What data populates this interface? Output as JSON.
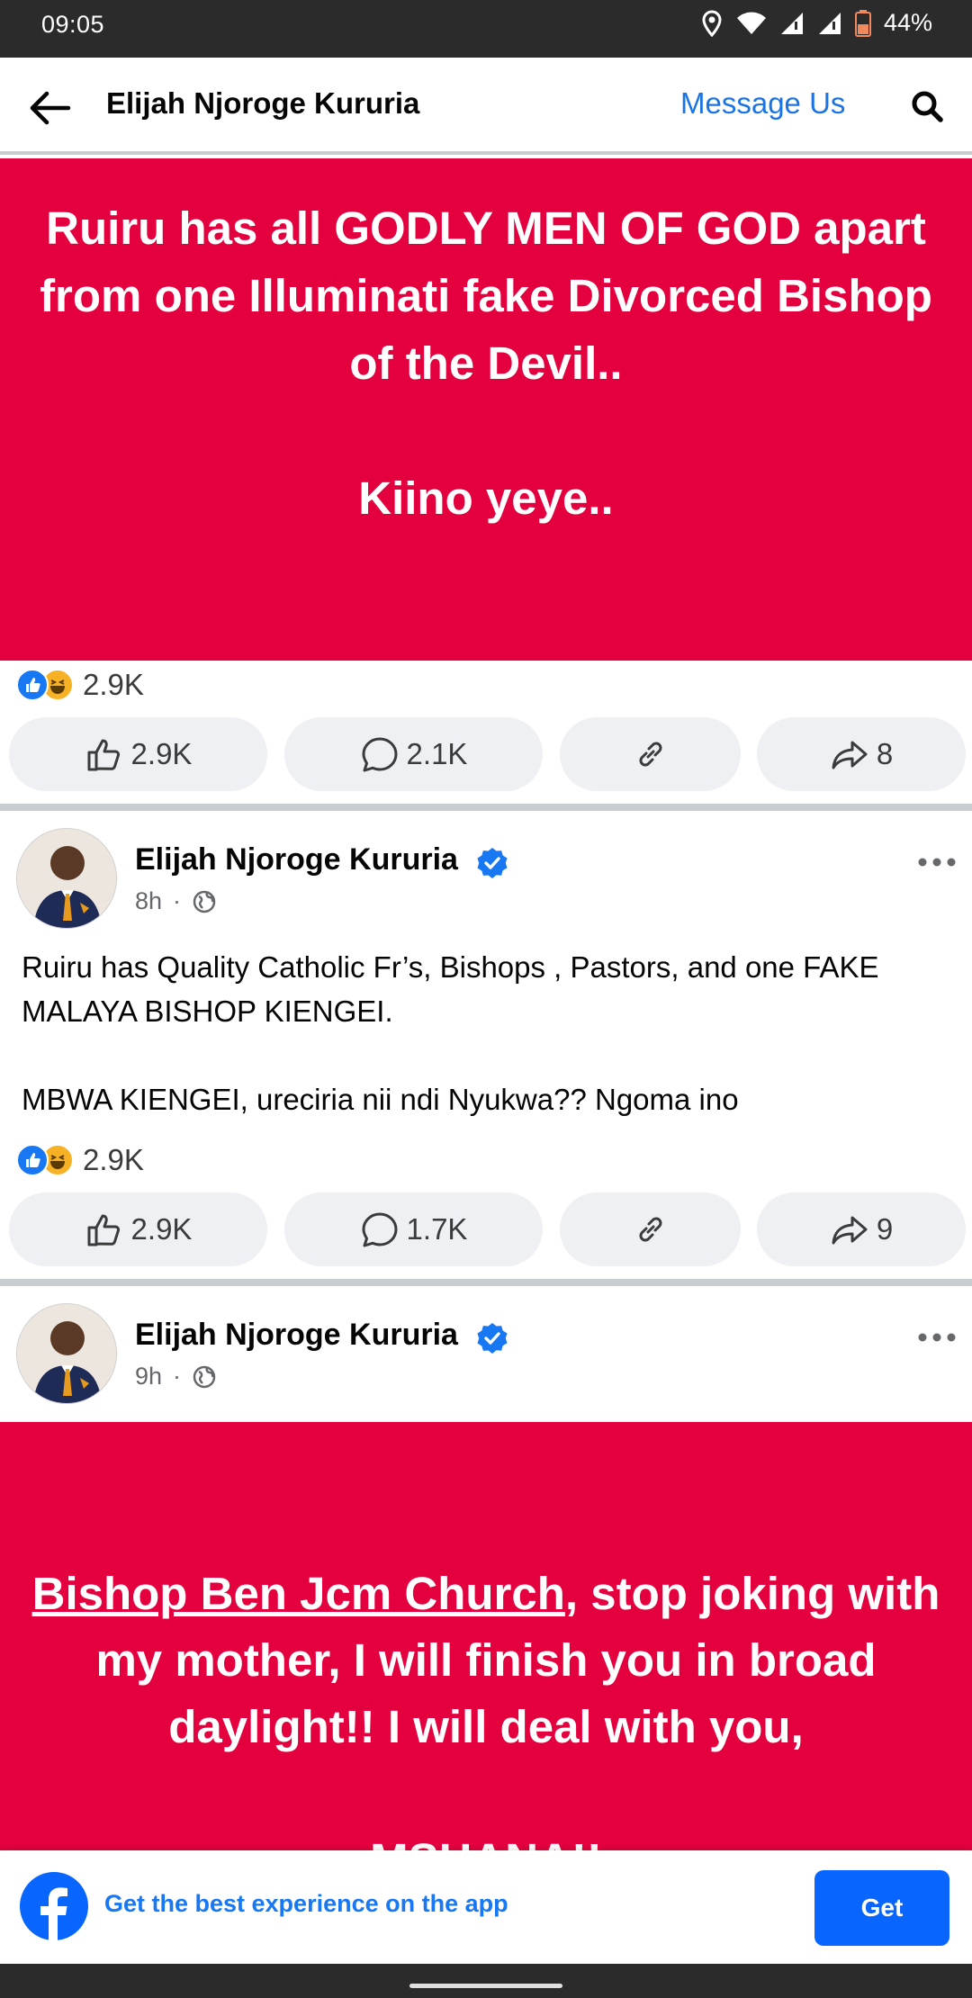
{
  "status_bar": {
    "time": "09:05",
    "battery": "44%",
    "icons": [
      "location-icon",
      "wifi-icon",
      "signal-icon",
      "signal-icon",
      "battery-icon"
    ]
  },
  "header": {
    "title": "Elijah Njoroge Kururia",
    "message_us": "Message Us",
    "back_icon": "arrow-left-icon",
    "search_icon": "search-icon"
  },
  "colors": {
    "post_background": "#e4003f",
    "accent": "#1b74e4",
    "get_button": "#0866ff"
  },
  "post1": {
    "text": "Ruiru has all GODLY MEN OF GOD apart from one Illuminati fake Divorced Bishop of the Devil..\n\nKiino yeye..",
    "reactions_count": "2.9K",
    "like_count": "2.9K",
    "comment_count": "2.1K",
    "share_count": "8"
  },
  "post2": {
    "author": "Elijah Njoroge Kururia",
    "time": "8h",
    "separator": "·",
    "body": "Ruiru has Quality Catholic Fr’s, Bishops , Pastors, and one FAKE MALAYA BISHOP KIENGEI.\n\nMBWA KIENGEI, ureciria nii ndi Nyukwa?? Ngoma ino",
    "reactions_count": "2.9K",
    "like_count": "2.9K",
    "comment_count": "1.7K",
    "share_count": "9"
  },
  "post3": {
    "author": "Elijah Njoroge Kururia",
    "time": "9h",
    "separator": "·",
    "link_text": "Bishop Ben Jcm Church",
    "text_rest": ", stop joking with my mother, I will finish you in broad daylight!! I will deal with you,",
    "partial_line": "MSHANA!!"
  },
  "app_banner": {
    "text": "Get the best experience on the app",
    "button": "Get"
  }
}
